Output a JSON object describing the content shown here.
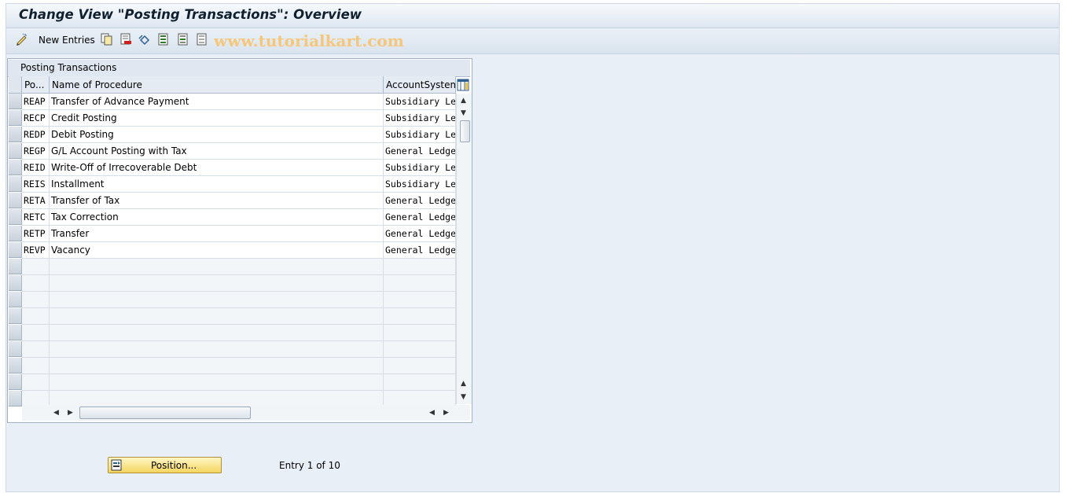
{
  "window": {
    "title": "Change View \"Posting Transactions\": Overview"
  },
  "toolbar": {
    "new_entries_label": "New Entries",
    "icons": [
      "edit-pencil-icon",
      "copy-icon",
      "delete-icon",
      "undo-icon",
      "select-all-icon",
      "select-block-icon",
      "deselect-all-icon"
    ],
    "watermark": "www.tutorialkart.com"
  },
  "table": {
    "caption": "Posting Transactions",
    "columns": [
      "Po...",
      "Name of Procedure",
      "AccountSystem"
    ],
    "rows": [
      {
        "code": "REAP",
        "name": "Transfer of Advance Payment",
        "account": "Subsidiary Le"
      },
      {
        "code": "RECP",
        "name": "Credit Posting",
        "account": "Subsidiary Le"
      },
      {
        "code": "REDP",
        "name": "Debit Posting",
        "account": "Subsidiary Le"
      },
      {
        "code": "REGP",
        "name": "G/L Account Posting with Tax",
        "account": "General Ledge"
      },
      {
        "code": "REID",
        "name": "Write-Off of Irrecoverable Debt",
        "account": "Subsidiary Le"
      },
      {
        "code": "REIS",
        "name": "Installment",
        "account": "Subsidiary Le"
      },
      {
        "code": "RETA",
        "name": "Transfer of Tax",
        "account": "General Ledge"
      },
      {
        "code": "RETC",
        "name": "Tax Correction",
        "account": "General Ledge"
      },
      {
        "code": "RETP",
        "name": "Transfer",
        "account": "General Ledge"
      },
      {
        "code": "REVP",
        "name": "Vacancy",
        "account": "General Ledge"
      }
    ],
    "empty_rows": 9
  },
  "footer": {
    "position_label": "Position...",
    "entry_text": "Entry 1 of 10"
  },
  "colors": {
    "background": "#e8eff6",
    "button": "#f4d55e",
    "watermark": "#f4c77d"
  }
}
